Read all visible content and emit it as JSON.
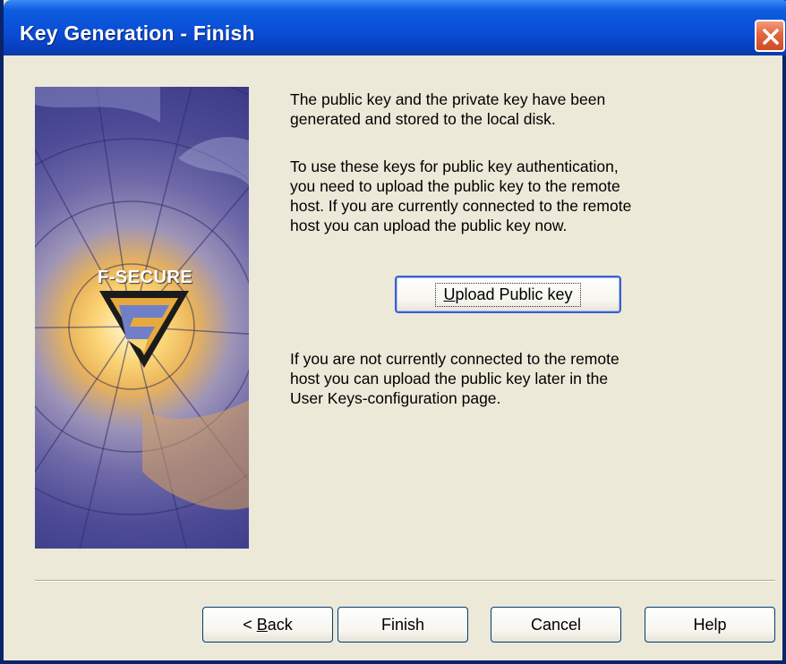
{
  "window": {
    "title": "Key Generation - Finish"
  },
  "image": {
    "logo_text": "F-SECURE"
  },
  "content": {
    "para1_line1": "The public key and the private key have been",
    "para1_line2": "generated and stored to the local disk.",
    "para2_line1": "To use these keys for public key authentication,",
    "para2_line2": "you need to upload the public key to the remote",
    "para2_line3": "host. If you are currently connected to the remote",
    "para2_line4": "host you can upload the public key now.",
    "upload_button_prefix": "U",
    "upload_button_rest": "pload Public key",
    "para3_line1": "If you are not currently connected to the remote",
    "para3_line2": "host you can upload the public key later in the",
    "para3_line3": "User Keys-configuration page."
  },
  "buttons": {
    "back_prefix": "< ",
    "back_mnemonic": "B",
    "back_rest": "ack",
    "finish": "Finish",
    "cancel": "Cancel",
    "help": "Help"
  },
  "colors": {
    "titlebar": "#0a4fd6",
    "close_button": "#e2643f",
    "dialog_bg": "#ece9d8"
  }
}
